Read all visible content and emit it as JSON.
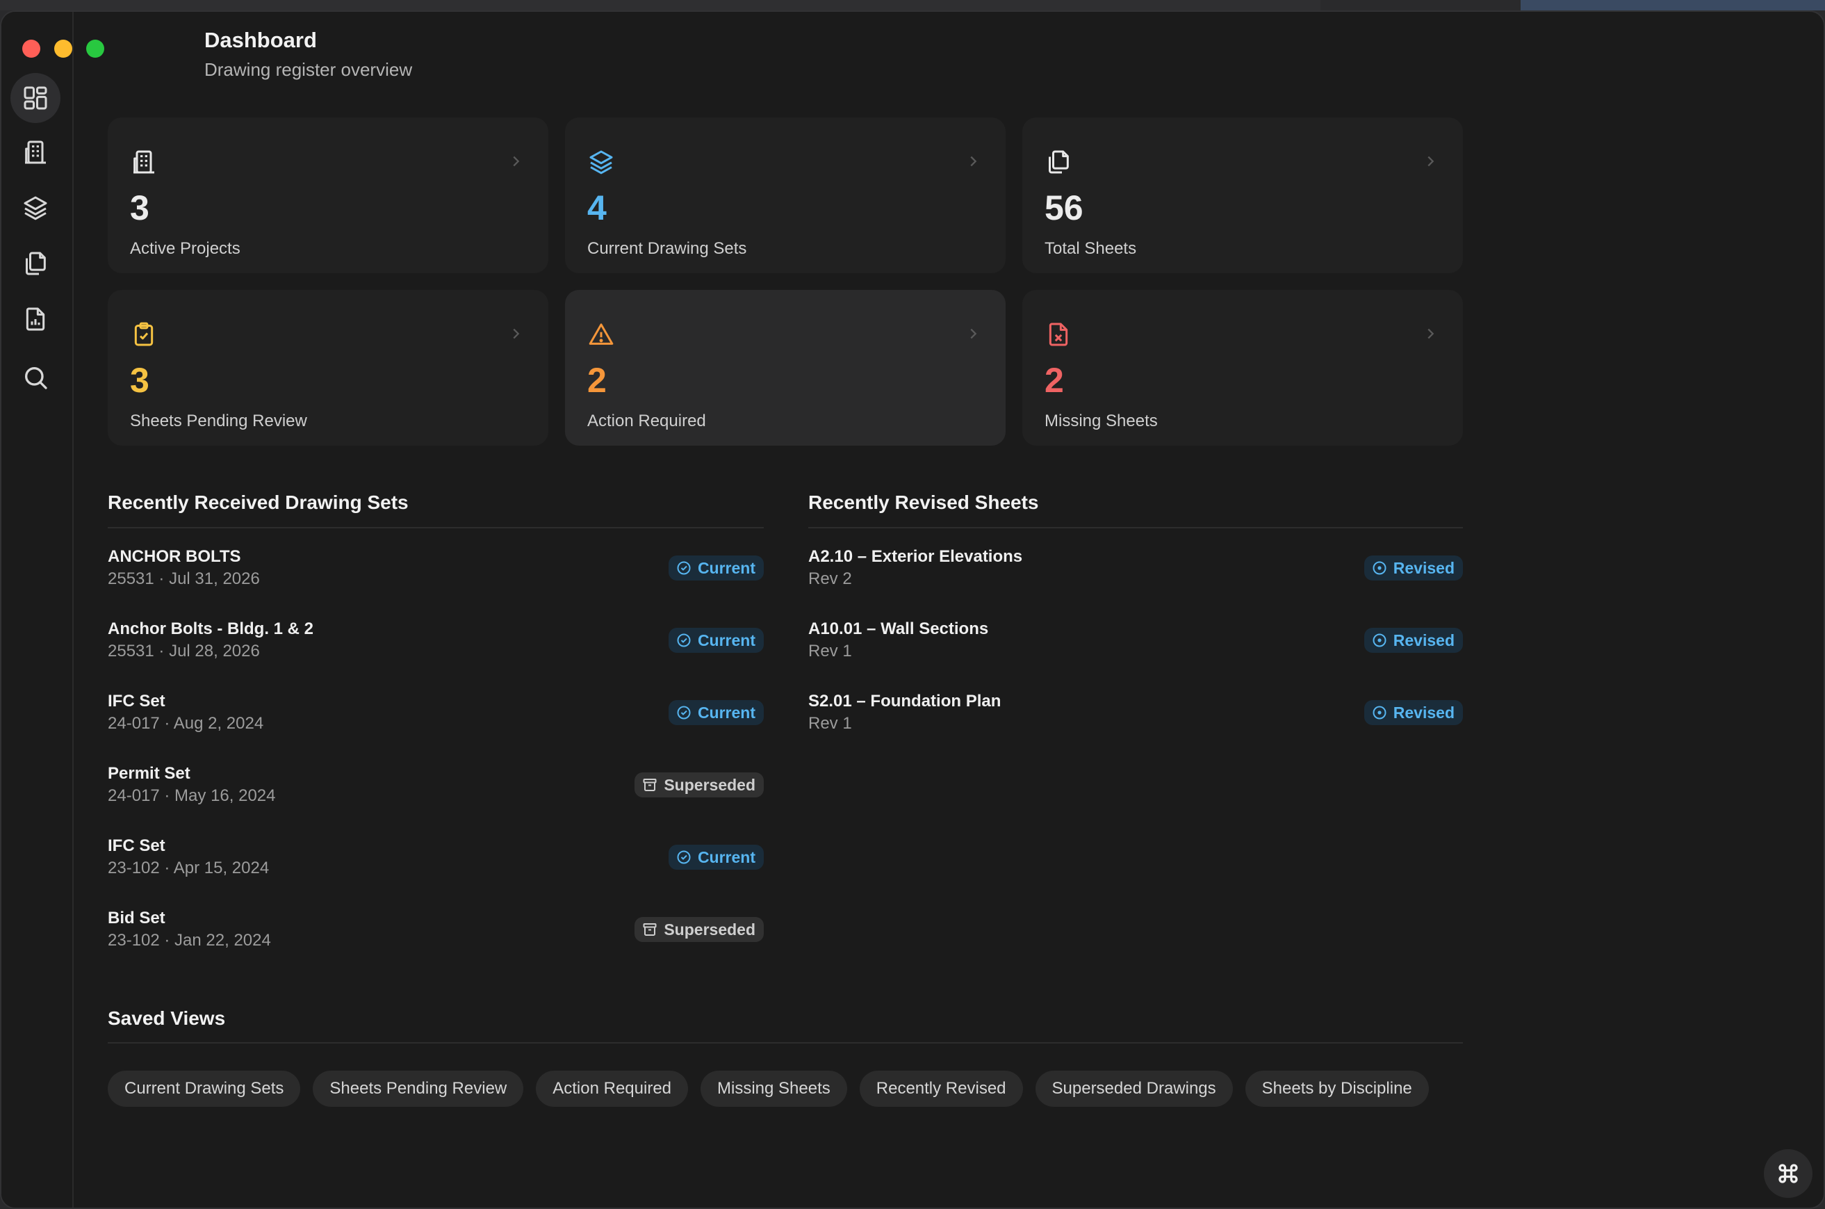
{
  "header": {
    "title": "Dashboard",
    "subtitle": "Drawing register overview"
  },
  "sidebar": {
    "items": [
      {
        "icon": "dashboard-icon",
        "active": true
      },
      {
        "icon": "building-icon",
        "active": false
      },
      {
        "icon": "layers-icon",
        "active": false
      },
      {
        "icon": "copy-sheets-icon",
        "active": false
      },
      {
        "icon": "report-icon",
        "active": false
      },
      {
        "icon": "search-icon",
        "active": false
      }
    ]
  },
  "stats": [
    {
      "value": "3",
      "label": "Active Projects",
      "icon": "building-icon",
      "color": "#f2f2f2"
    },
    {
      "value": "4",
      "label": "Current Drawing Sets",
      "icon": "layers-icon",
      "color": "#57b5f0"
    },
    {
      "value": "56",
      "label": "Total Sheets",
      "icon": "copy-sheets-icon",
      "color": "#f2f2f2"
    },
    {
      "value": "3",
      "label": "Sheets Pending Review",
      "icon": "clipboard-check-icon",
      "color": "#f5c242"
    },
    {
      "value": "2",
      "label": "Action Required",
      "icon": "warning-icon",
      "color": "#f5963a"
    },
    {
      "value": "2",
      "label": "Missing Sheets",
      "icon": "file-x-icon",
      "color": "#ef6363"
    }
  ],
  "recent_sets": {
    "title": "Recently Received Drawing Sets",
    "items": [
      {
        "name": "ANCHOR BOLTS",
        "meta": "25531 · Jul 31, 2026",
        "status": "Current"
      },
      {
        "name": "Anchor Bolts - Bldg. 1 & 2",
        "meta": "25531 · Jul 28, 2026",
        "status": "Current"
      },
      {
        "name": "IFC Set",
        "meta": "24-017 · Aug 2, 2024",
        "status": "Current"
      },
      {
        "name": "Permit Set",
        "meta": "24-017 · May 16, 2024",
        "status": "Superseded"
      },
      {
        "name": "IFC Set",
        "meta": "23-102 · Apr 15, 2024",
        "status": "Current"
      },
      {
        "name": "Bid Set",
        "meta": "23-102 · Jan 22, 2024",
        "status": "Superseded"
      }
    ]
  },
  "revised_sheets": {
    "title": "Recently Revised Sheets",
    "items": [
      {
        "name": "A2.10 – Exterior Elevations",
        "meta": "Rev 2",
        "status": "Revised"
      },
      {
        "name": "A10.01 – Wall Sections",
        "meta": "Rev 1",
        "status": "Revised"
      },
      {
        "name": "S2.01 – Foundation Plan",
        "meta": "Rev 1",
        "status": "Revised"
      }
    ]
  },
  "saved_views": {
    "title": "Saved Views",
    "chips": [
      "Current Drawing Sets",
      "Sheets Pending Review",
      "Action Required",
      "Missing Sheets",
      "Recently Revised",
      "Superseded Drawings",
      "Sheets by Discipline"
    ]
  },
  "colors": {
    "accent": "#57b5f0",
    "background": "#1b1b1b",
    "card": "#212121"
  }
}
